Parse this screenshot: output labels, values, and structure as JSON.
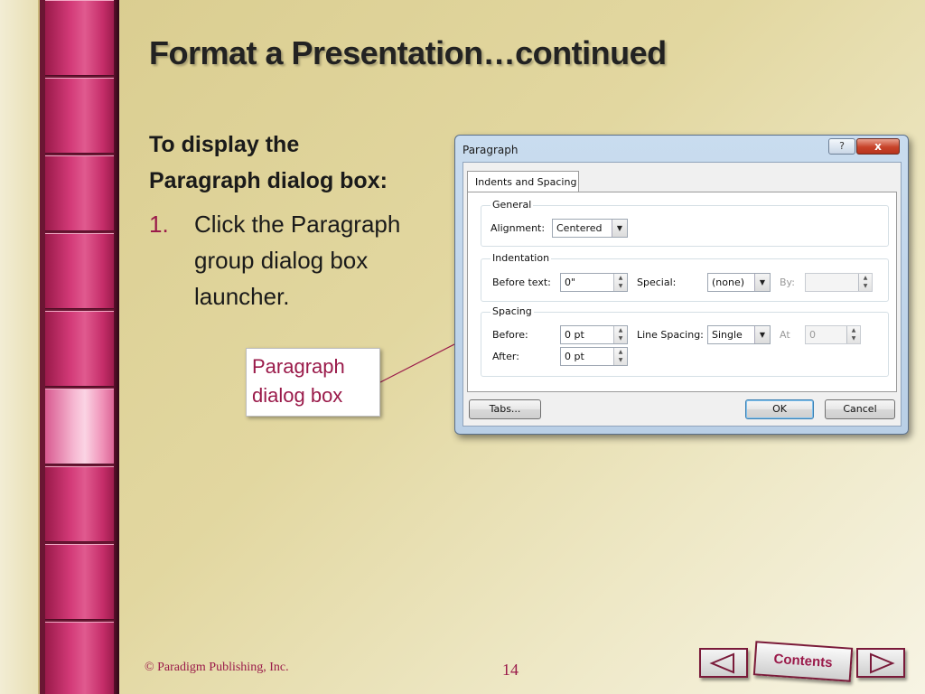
{
  "slide": {
    "title": "Format a Presentation…continued",
    "subhead_line1": "To display the",
    "subhead_line2": "Paragraph dialog box:",
    "step_number": "1.",
    "step_line1": "Click the Paragraph",
    "step_line2": "group dialog box",
    "step_line3": "launcher.",
    "callout_line1": "Paragraph",
    "callout_line2": "dialog box"
  },
  "dialog": {
    "title": "Paragraph",
    "help": "?",
    "close": "x",
    "tab": "Indents and Spacing",
    "general": {
      "title": "General",
      "alignment_label": "Alignment:",
      "alignment_value": "Centered"
    },
    "indentation": {
      "title": "Indentation",
      "before_label": "Before text:",
      "before_value": "0\"",
      "special_label": "Special:",
      "special_value": "(none)",
      "by_label": "By:"
    },
    "spacing": {
      "title": "Spacing",
      "before_label": "Before:",
      "before_value": "0 pt",
      "after_label": "After:",
      "after_value": "0 pt",
      "line_spacing_label": "Line Spacing:",
      "line_spacing_value": "Single",
      "at_label": "At",
      "at_value": "0"
    },
    "buttons": {
      "tabs": "Tabs...",
      "ok": "OK",
      "cancel": "Cancel"
    }
  },
  "footer": {
    "copyright": "© Paradigm Publishing, Inc.",
    "page_number": "14",
    "contents": "Contents"
  },
  "colors": {
    "accent": "#9a1a4a",
    "rail": "#d33a78"
  }
}
